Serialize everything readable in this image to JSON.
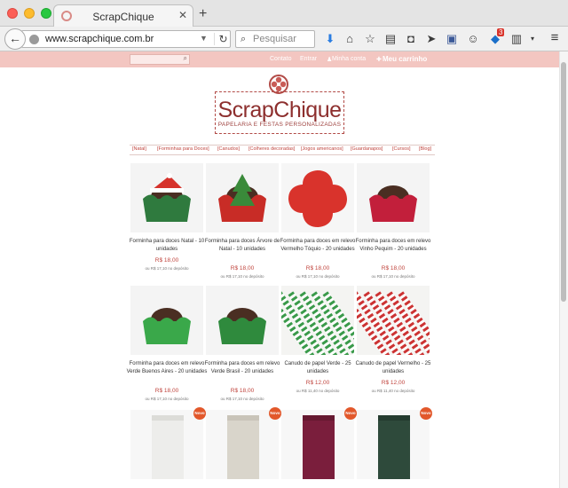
{
  "browser": {
    "tab_title": "ScrapChique",
    "tab_close": "✕",
    "new_tab": "+",
    "url": "www.scrapchique.com.br",
    "search_placeholder": "Pesquisar",
    "notification_count": "3"
  },
  "header": {
    "links": [
      "Contato",
      "Entrar",
      "Minha conta",
      "Meu carrinho"
    ]
  },
  "logo": {
    "name": "ScrapChique",
    "tagline": "PAPELARIA E FESTAS PERSONALIZADAS"
  },
  "categories": [
    "[Natal]",
    "[Forminhas para Doces]",
    "[Canudos]",
    "[Colheres decoradas]",
    "[Jogos americanos]",
    "[Guardanapos]",
    "[Cursos]",
    "[Blog]"
  ],
  "products": [
    {
      "name": "Forminha para doces Natal - 10 unidades",
      "price": "R$ 18,00",
      "deposit": "ou R$ 17,10 no depósito",
      "color": "#2f7a3e",
      "accent": "#d6322b"
    },
    {
      "name": "Forminha para doces Árvore de Natal - 10 unidades",
      "price": "R$ 18,00",
      "deposit": "ou R$ 17,10 no depósito",
      "color": "#c82c26",
      "accent": "#3a8a3a"
    },
    {
      "name": "Forminha para doces em relevo Vermelho Tóquio - 20 unidades",
      "price": "R$ 18,00",
      "deposit": "ou R$ 17,10 no depósito",
      "color": "#d9332c",
      "accent": "#d9332c"
    },
    {
      "name": "Forminha para doces em relevo Vinho Pequim - 20 unidades",
      "price": "R$ 18,00",
      "deposit": "ou R$ 17,10 no depósito",
      "color": "#c21f3b",
      "accent": "#5a3a2a"
    },
    {
      "name": "Forminha para doces em relevo Verde Buenos Aires - 20 unidades",
      "price": "R$ 18,00",
      "deposit": "ou R$ 17,10 no depósito",
      "color": "#3aa84a",
      "accent": "#5a3a2a"
    },
    {
      "name": "Forminha para doces em relevo Verde Brasil - 20 unidades",
      "price": "R$ 18,00",
      "deposit": "ou R$ 17,10 no depósito",
      "color": "#2f8a3d",
      "accent": "#5a3a2a"
    },
    {
      "name": "Canudo de papel Verde - 25 unidades",
      "price": "R$ 12,00",
      "deposit": "ou R$ 11,40 no depósito",
      "color": "#3a9a4a",
      "accent": "#ffffff"
    },
    {
      "name": "Canudo de papel Vermelho - 25 unidades",
      "price": "R$ 12,00",
      "deposit": "ou R$ 11,40 no depósito",
      "color": "#cc3333",
      "accent": "#ffffff"
    },
    {
      "name": "",
      "price": "",
      "deposit": "",
      "color": "#ededeb",
      "accent": "#dcdcd8",
      "new_label": "Novo"
    },
    {
      "name": "",
      "price": "",
      "deposit": "",
      "color": "#d9d5cb",
      "accent": "#c9c4b9",
      "new_label": "Novo"
    },
    {
      "name": "",
      "price": "",
      "deposit": "",
      "color": "#7a1e3c",
      "accent": "#651830",
      "new_label": "Novo"
    },
    {
      "name": "",
      "price": "",
      "deposit": "",
      "color": "#2e4a3b",
      "accent": "#243b2f",
      "new_label": "Novo"
    }
  ]
}
